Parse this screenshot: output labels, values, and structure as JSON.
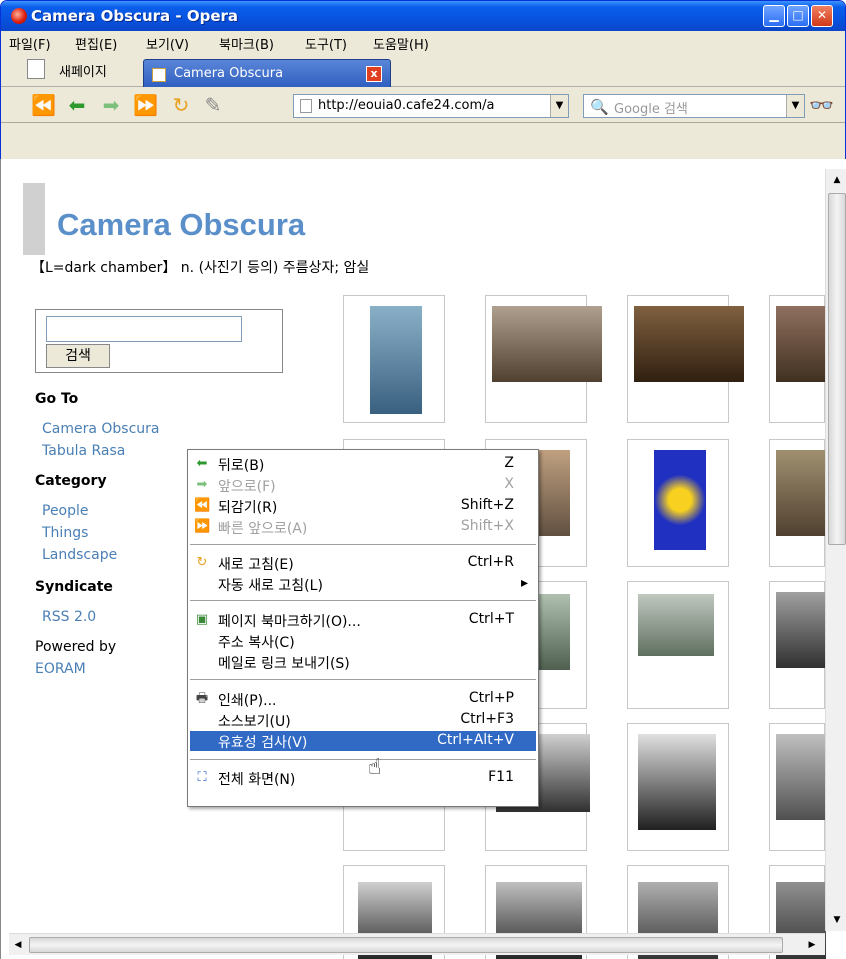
{
  "window": {
    "title": "Camera Obscura - Opera",
    "minimize": "▁",
    "maximize": "□",
    "close": "✕"
  },
  "menubar": [
    "파일(F)",
    "편집(E)",
    "보기(V)",
    "북마크(B)",
    "도구(T)",
    "도움말(H)"
  ],
  "tabs": {
    "new_page": "새페이지",
    "active": "Camera Obscura"
  },
  "address": {
    "url": "http://eouia0.cafe24.com/a",
    "search_placeholder": "Google 검색"
  },
  "page": {
    "title": "Camera Obscura",
    "description": "【L=dark chamber】 n. (사진기 등의) 주름상자; 암실",
    "search_button": "검색",
    "goto_heading": "Go To",
    "goto_links": [
      "Camera Obscura",
      "Tabula Rasa"
    ],
    "category_heading": "Category",
    "category_links": [
      "People",
      "Things",
      "Landscape"
    ],
    "syndicate_heading": "Syndicate",
    "syndicate_links": [
      "RSS 2.0"
    ],
    "powered_by": "Powered by",
    "powered_link": "EORAM"
  },
  "context_menu": [
    {
      "label": "뒤로(B)",
      "shortcut": "Z",
      "icon": "back-icon",
      "disabled": false
    },
    {
      "label": "앞으로(F)",
      "shortcut": "X",
      "icon": "forward-icon",
      "disabled": true
    },
    {
      "label": "되감기(R)",
      "shortcut": "Shift+Z",
      "icon": "rewind-icon",
      "disabled": false
    },
    {
      "label": "빠른 앞으로(A)",
      "shortcut": "Shift+X",
      "icon": "fast-forward-icon",
      "disabled": true
    },
    {
      "label": "새로 고침(E)",
      "shortcut": "Ctrl+R",
      "icon": "reload-icon",
      "disabled": false
    },
    {
      "label": "자동 새로 고침(L)",
      "shortcut": "▸",
      "icon": "",
      "disabled": false
    },
    {
      "label": "페이지 북마크하기(O)...",
      "shortcut": "Ctrl+T",
      "icon": "bookmark-icon",
      "disabled": false
    },
    {
      "label": "주소 복사(C)",
      "shortcut": "",
      "icon": "",
      "disabled": false
    },
    {
      "label": "메일로 링크 보내기(S)",
      "shortcut": "",
      "icon": "",
      "disabled": false
    },
    {
      "label": "인쇄(P)...",
      "shortcut": "Ctrl+P",
      "icon": "print-icon",
      "disabled": false
    },
    {
      "label": "소스보기(U)",
      "shortcut": "Ctrl+F3",
      "icon": "",
      "disabled": false
    },
    {
      "label": "유효성 검사(V)",
      "shortcut": "Ctrl+Alt+V",
      "icon": "",
      "disabled": false,
      "highlighted": true
    },
    {
      "label": "전체 화면(N)",
      "shortcut": "F11",
      "icon": "fullscreen-icon",
      "disabled": false
    }
  ]
}
